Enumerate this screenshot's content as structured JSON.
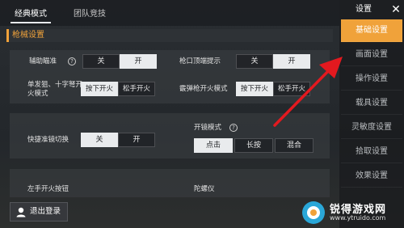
{
  "tabs": [
    {
      "label": "经典模式",
      "active": true
    },
    {
      "label": "团队竞技",
      "active": false
    }
  ],
  "section_title": "枪械设置",
  "settings": {
    "aim_assist": {
      "label": "辅助瞄准",
      "options": [
        "关",
        "开"
      ],
      "selected": "开"
    },
    "muzzle_hint": {
      "label": "枪口顶端提示",
      "options": [
        "关",
        "开"
      ],
      "selected": "开"
    },
    "single_shot": {
      "label": "单发狙、十字弩开火模式",
      "options": [
        "按下开火",
        "松手开火"
      ],
      "selected": "按下开火"
    },
    "shotgun_fire": {
      "label": "霰弹枪开火模式",
      "options": [
        "按下开火",
        "松手开火"
      ],
      "selected": "按下开火"
    },
    "quick_scope": {
      "label": "快捷准镜切换",
      "options": [
        "关",
        "开"
      ],
      "selected": "关"
    },
    "scope_mode": {
      "label": "开镜模式",
      "options": [
        "点击",
        "长按",
        "混合"
      ],
      "selected": "点击"
    },
    "left_fire": {
      "label": "左手开火按钮"
    },
    "gyro": {
      "label": "陀螺仪"
    }
  },
  "sidebar": {
    "title": "设置",
    "items": [
      {
        "label": "基础设置",
        "active": true
      },
      {
        "label": "画面设置",
        "active": false
      },
      {
        "label": "操作设置",
        "active": false
      },
      {
        "label": "载具设置",
        "active": false
      },
      {
        "label": "灵敏度设置",
        "active": false
      },
      {
        "label": "拾取设置",
        "active": false
      },
      {
        "label": "效果设置",
        "active": false
      }
    ]
  },
  "logout_label": "退出登录",
  "watermark": {
    "title": "锐得游戏网",
    "url": "www.ytruido.com"
  },
  "colors": {
    "accent": "#f0a23a",
    "arrow": "#e3191f"
  }
}
